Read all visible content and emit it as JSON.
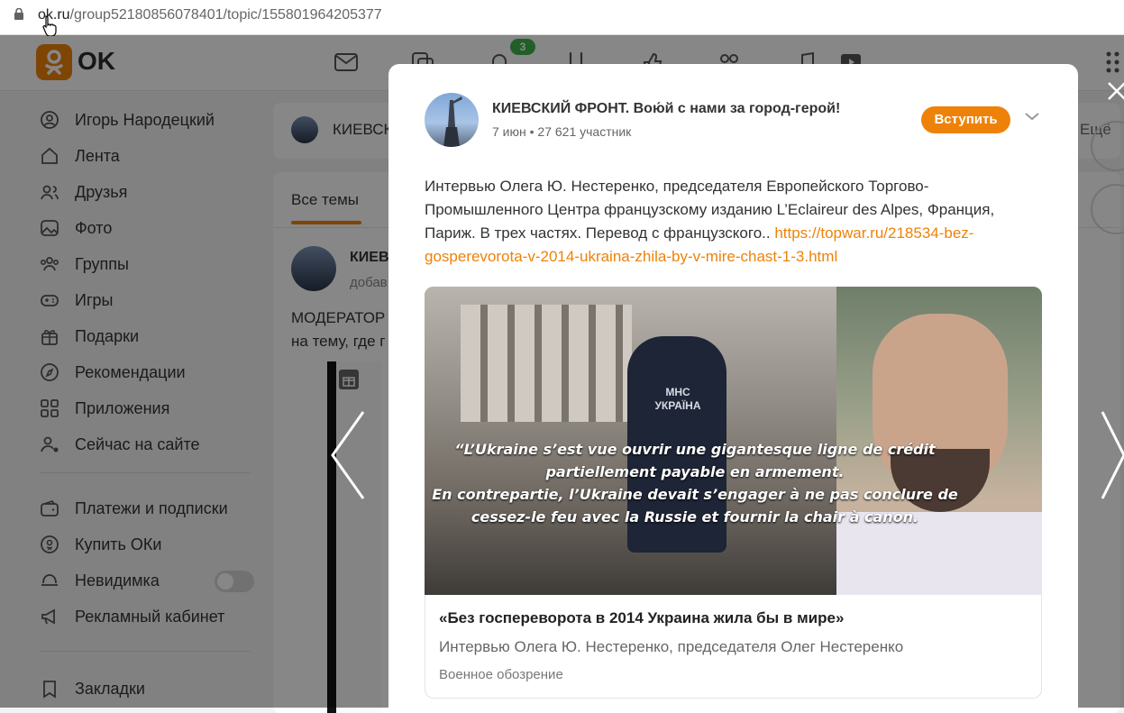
{
  "browser": {
    "url_host": "ok.ru",
    "url_path": "/group52180856078401/topic/155801964205377"
  },
  "header": {
    "logo_text": "OK",
    "notification_count": "3"
  },
  "sidebar": {
    "items": [
      {
        "label": "Игорь Народецкий",
        "icon": "user-icon"
      },
      {
        "label": "Лента",
        "icon": "home-icon"
      },
      {
        "label": "Друзья",
        "icon": "friends-icon"
      },
      {
        "label": "Фото",
        "icon": "photo-icon"
      },
      {
        "label": "Группы",
        "icon": "groups-icon"
      },
      {
        "label": "Игры",
        "icon": "gamepad-icon"
      },
      {
        "label": "Подарки",
        "icon": "gift-icon"
      },
      {
        "label": "Рекомендации",
        "icon": "compass-icon"
      },
      {
        "label": "Приложения",
        "icon": "apps-icon"
      },
      {
        "label": "Сейчас на сайте",
        "icon": "online-users-icon"
      }
    ],
    "items2": [
      {
        "label": "Платежи и подписки",
        "icon": "wallet-icon"
      },
      {
        "label": "Купить ОКи",
        "icon": "coin-icon"
      },
      {
        "label": "Невидимка",
        "icon": "invisible-icon"
      },
      {
        "label": "Рекламный кабинет",
        "icon": "megaphone-icon"
      }
    ],
    "items3": [
      {
        "label": "Закладки",
        "icon": "bookmark-icon"
      }
    ]
  },
  "group_bg": {
    "name_partial": "КИЕВСК",
    "tab_all_topics": "Все темы",
    "post_author_partial": "КИЕВ",
    "post_meta_partial": "добав",
    "post_text_line1": "МОДЕРАТОР",
    "post_text_line2": "на тему, где г",
    "more_label": "Ещё"
  },
  "modal": {
    "group_name": "КИЕВСКИЙ ФРОНТ. Вою́й с нами за город-герой!",
    "date": "7 июн",
    "members": "27 621 участник",
    "join_label": "Вступить",
    "text": "Интервью Олега Ю. Нестеренко, председателя Европейского Торгово-Промышленного Центра французскому изданию L’Eclaireur des Alpes, Франция, Париж. В трех частях. Перевод с французского.. ",
    "link": "https://topwar.ru/218534-bez-gosperevorota-v-2014-ukraina-zhila-by-v-mire-chast-1-3.html",
    "image_quote_1": "“L’Ukraine s’est vue ouvrir une gigantesque ligne de crédit",
    "image_quote_2": "partiellement payable en armement.",
    "image_quote_3": "En contrepartie, l’Ukraine devait s’engager à ne pas conclure de",
    "image_quote_4": "cessez-le feu avec la Russie et fournir la chair à canon.",
    "vest_text": "МНС\nУКРАЇНА",
    "link_card": {
      "title": "«Без госпереворота в 2014 Украина жила бы в мире»",
      "description": "Интервью Олега Ю. Нестеренко, председателя Олег Нестеренко",
      "source": "Военное обозрение"
    }
  },
  "colors": {
    "accent": "#ee8208",
    "badge": "#3fb34f",
    "overlay": "rgba(0,0,0,0.47)"
  }
}
